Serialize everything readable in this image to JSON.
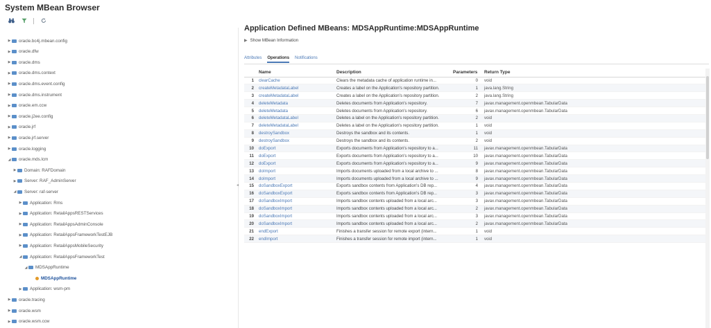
{
  "app": {
    "title": "System MBean Browser"
  },
  "toolbar": {
    "icons": [
      "binoculars-icon",
      "filter-icon",
      "refresh-icon"
    ]
  },
  "tree": {
    "items": [
      {
        "label": "oracle.bc4j.mbean.config",
        "level": 0,
        "expanded": false,
        "type": "folder"
      },
      {
        "label": "oracle.dfw",
        "level": 0,
        "expanded": false,
        "type": "folder"
      },
      {
        "label": "oracle.dms",
        "level": 0,
        "expanded": false,
        "type": "folder"
      },
      {
        "label": "oracle.dms.context",
        "level": 0,
        "expanded": false,
        "type": "folder"
      },
      {
        "label": "oracle.dms.event.config",
        "level": 0,
        "expanded": false,
        "type": "folder"
      },
      {
        "label": "oracle.dms.instrument",
        "level": 0,
        "expanded": false,
        "type": "folder"
      },
      {
        "label": "oracle.em.ccw",
        "level": 0,
        "expanded": false,
        "type": "folder"
      },
      {
        "label": "oracle.j2ee.config",
        "level": 0,
        "expanded": false,
        "type": "folder"
      },
      {
        "label": "oracle.jrf",
        "level": 0,
        "expanded": false,
        "type": "folder"
      },
      {
        "label": "oracle.jrf.server",
        "level": 0,
        "expanded": false,
        "type": "folder"
      },
      {
        "label": "oracle.logging",
        "level": 0,
        "expanded": false,
        "type": "folder"
      },
      {
        "label": "oracle.mds.lcm",
        "level": 0,
        "expanded": true,
        "type": "folder"
      },
      {
        "label": "Domain: RAFDomain",
        "level": 1,
        "expanded": false,
        "type": "folder"
      },
      {
        "label": "Server: RAF_AdminServer",
        "level": 1,
        "expanded": false,
        "type": "folder"
      },
      {
        "label": "Server: raf-server",
        "level": 1,
        "expanded": true,
        "type": "folder"
      },
      {
        "label": "Application: Rms",
        "level": 2,
        "expanded": false,
        "type": "folder"
      },
      {
        "label": "Application: RetailAppsRESTServices",
        "level": 2,
        "expanded": false,
        "type": "folder"
      },
      {
        "label": "Application: RetailAppsAdminConsole",
        "level": 2,
        "expanded": false,
        "type": "folder"
      },
      {
        "label": "Application: RetailAppsFrameworkTestEJB",
        "level": 2,
        "expanded": false,
        "type": "folder"
      },
      {
        "label": "Application: RetailAppsMobileSecurity",
        "level": 2,
        "expanded": false,
        "type": "folder"
      },
      {
        "label": "Application: RetailAppsFrameworkTest",
        "level": 2,
        "expanded": true,
        "type": "folder"
      },
      {
        "label": "MDSAppRuntime",
        "level": 3,
        "expanded": true,
        "type": "folder"
      },
      {
        "label": "MDSAppRuntime",
        "level": 4,
        "expanded": false,
        "type": "bean",
        "selected": true
      },
      {
        "label": "Application: wsm-pm",
        "level": 2,
        "expanded": false,
        "type": "folder"
      },
      {
        "label": "oracle.tracing",
        "level": 0,
        "expanded": false,
        "type": "folder"
      },
      {
        "label": "oracle.wsm",
        "level": 0,
        "expanded": false,
        "type": "folder"
      },
      {
        "label": "oracle.wsm.ccw",
        "level": 0,
        "expanded": false,
        "type": "folder"
      }
    ]
  },
  "main": {
    "title": "Application Defined MBeans: MDSAppRuntime:MDSAppRuntime",
    "show_info": "Show MBean Information",
    "tabs": [
      {
        "label": "Attributes",
        "active": false
      },
      {
        "label": "Operations",
        "active": true
      },
      {
        "label": "Notifications",
        "active": false
      }
    ],
    "table": {
      "columns": [
        "",
        "Name",
        "Description",
        "Parameters",
        "Return Type"
      ],
      "rows": [
        {
          "num": "1",
          "name": "clearCache",
          "desc": "Clears the metadata cache of application runtime in...",
          "params": "0",
          "rtype": "void"
        },
        {
          "num": "2",
          "name": "createMetadataLabel",
          "desc": "Creates a label on the Application's repository partition.",
          "params": "1",
          "rtype": "java.lang.String"
        },
        {
          "num": "3",
          "name": "createMetadataLabel",
          "desc": "Creates a label on the Application's repository partition.",
          "params": "2",
          "rtype": "java.lang.String"
        },
        {
          "num": "4",
          "name": "deleteMetadata",
          "desc": "Deletes documents from Application's repository.",
          "params": "7",
          "rtype": "javax.management.openmbean.TabularData"
        },
        {
          "num": "5",
          "name": "deleteMetadata",
          "desc": "Deletes documents from Application's repository.",
          "params": "6",
          "rtype": "javax.management.openmbean.TabularData"
        },
        {
          "num": "6",
          "name": "deleteMetadataLabel",
          "desc": "Deletes a label on the Application's repository partition.",
          "params": "2",
          "rtype": "void"
        },
        {
          "num": "7",
          "name": "deleteMetadataLabel",
          "desc": "Deletes a label on the Application's repository partition.",
          "params": "1",
          "rtype": "void"
        },
        {
          "num": "8",
          "name": "destroySandbox",
          "desc": "Destroys the sandbox and its contents.",
          "params": "1",
          "rtype": "void"
        },
        {
          "num": "9",
          "name": "destroySandbox",
          "desc": "Destroys the sandbox and its contents.",
          "params": "2",
          "rtype": "void"
        },
        {
          "num": "10",
          "name": "doExport",
          "desc": "Exports documents from Application's repository to a...",
          "params": "11",
          "rtype": "javax.management.openmbean.TabularData"
        },
        {
          "num": "11",
          "name": "doExport",
          "desc": "Exports documents from Application's repository to a...",
          "params": "10",
          "rtype": "javax.management.openmbean.TabularData"
        },
        {
          "num": "12",
          "name": "doExport",
          "desc": "Exports documents from Application's repository to a...",
          "params": "9",
          "rtype": "javax.management.openmbean.TabularData"
        },
        {
          "num": "13",
          "name": "doImport",
          "desc": "Imports documents uploaded from a local archive to ...",
          "params": "8",
          "rtype": "javax.management.openmbean.TabularData"
        },
        {
          "num": "14",
          "name": "doImport",
          "desc": "Imports documents uploaded from a local archive to ...",
          "params": "9",
          "rtype": "javax.management.openmbean.TabularData"
        },
        {
          "num": "15",
          "name": "doSandboxExport",
          "desc": "Exports sandbox contents from Application's DB rep...",
          "params": "4",
          "rtype": "javax.management.openmbean.TabularData"
        },
        {
          "num": "16",
          "name": "doSandboxExport",
          "desc": "Exports sandbox contents from Application's DB rep...",
          "params": "3",
          "rtype": "javax.management.openmbean.TabularData"
        },
        {
          "num": "17",
          "name": "doSandboxImport",
          "desc": "Imports sandbox contents uploaded from a local arc...",
          "params": "3",
          "rtype": "javax.management.openmbean.TabularData"
        },
        {
          "num": "18",
          "name": "doSandboxImport",
          "desc": "Imports sandbox contents uploaded from a local arc...",
          "params": "2",
          "rtype": "javax.management.openmbean.TabularData"
        },
        {
          "num": "19",
          "name": "doSandboxImport",
          "desc": "Imports sandbox contents uploaded from a local arc...",
          "params": "3",
          "rtype": "javax.management.openmbean.TabularData"
        },
        {
          "num": "20",
          "name": "doSandboxImport",
          "desc": "Imports sandbox contents uploaded from a local arc...",
          "params": "2",
          "rtype": "javax.management.openmbean.TabularData"
        },
        {
          "num": "21",
          "name": "endExport",
          "desc": "Finishes a transfer session for remote export (intern...",
          "params": "1",
          "rtype": "void"
        },
        {
          "num": "22",
          "name": "endImport",
          "desc": "Finishes a transfer session for remote import (intern...",
          "params": "1",
          "rtype": "void"
        }
      ]
    }
  }
}
